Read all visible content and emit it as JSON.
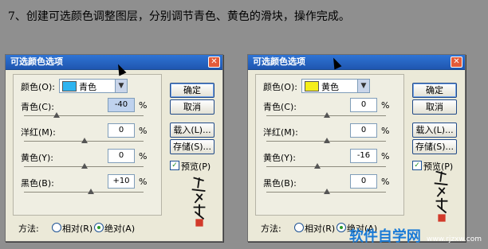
{
  "caption": "7、创建可选颜色调整图层，分别调节青色、黄色的滑块，操作完成。",
  "dialogs": [
    {
      "title": "可选颜色选项",
      "color_label": "颜色(O):",
      "color_value": "青色",
      "swatch_color": "#2fb4f0",
      "params": [
        {
          "label": "青色(C):",
          "value": "-40",
          "slider_level": -0.4
        },
        {
          "label": "洋红(M):",
          "value": "0",
          "slider_level": 0
        },
        {
          "label": "黄色(Y):",
          "value": "0",
          "slider_level": 0
        },
        {
          "label": "黑色(B):",
          "value": "+10",
          "slider_level": 0.1
        }
      ],
      "percent": "%",
      "buttons": {
        "ok": "确定",
        "cancel": "取消",
        "load": "载入(L)...",
        "save": "存储(S)..."
      },
      "preview_label": "预览(P)",
      "method_label": "方法:",
      "method_relative": "相对(R)",
      "method_absolute": "绝对(A)"
    },
    {
      "title": "可选颜色选项",
      "color_label": "颜色(O):",
      "color_value": "黄色",
      "swatch_color": "#f5ee1a",
      "params": [
        {
          "label": "青色(C):",
          "value": "0",
          "slider_level": 0
        },
        {
          "label": "洋红(M):",
          "value": "0",
          "slider_level": 0
        },
        {
          "label": "黄色(Y):",
          "value": "-16",
          "slider_level": -0.16
        },
        {
          "label": "黑色(B):",
          "value": "0",
          "slider_level": 0
        }
      ],
      "percent": "%",
      "buttons": {
        "ok": "确定",
        "cancel": "取消",
        "load": "载入(L)...",
        "save": "存储(S)..."
      },
      "preview_label": "预览(P)",
      "method_label": "方法:",
      "method_relative": "相对(R)",
      "method_absolute": "绝对(A)"
    }
  ],
  "watermark": {
    "main": "软件自学网",
    "url": "www.rjzxw.com"
  }
}
